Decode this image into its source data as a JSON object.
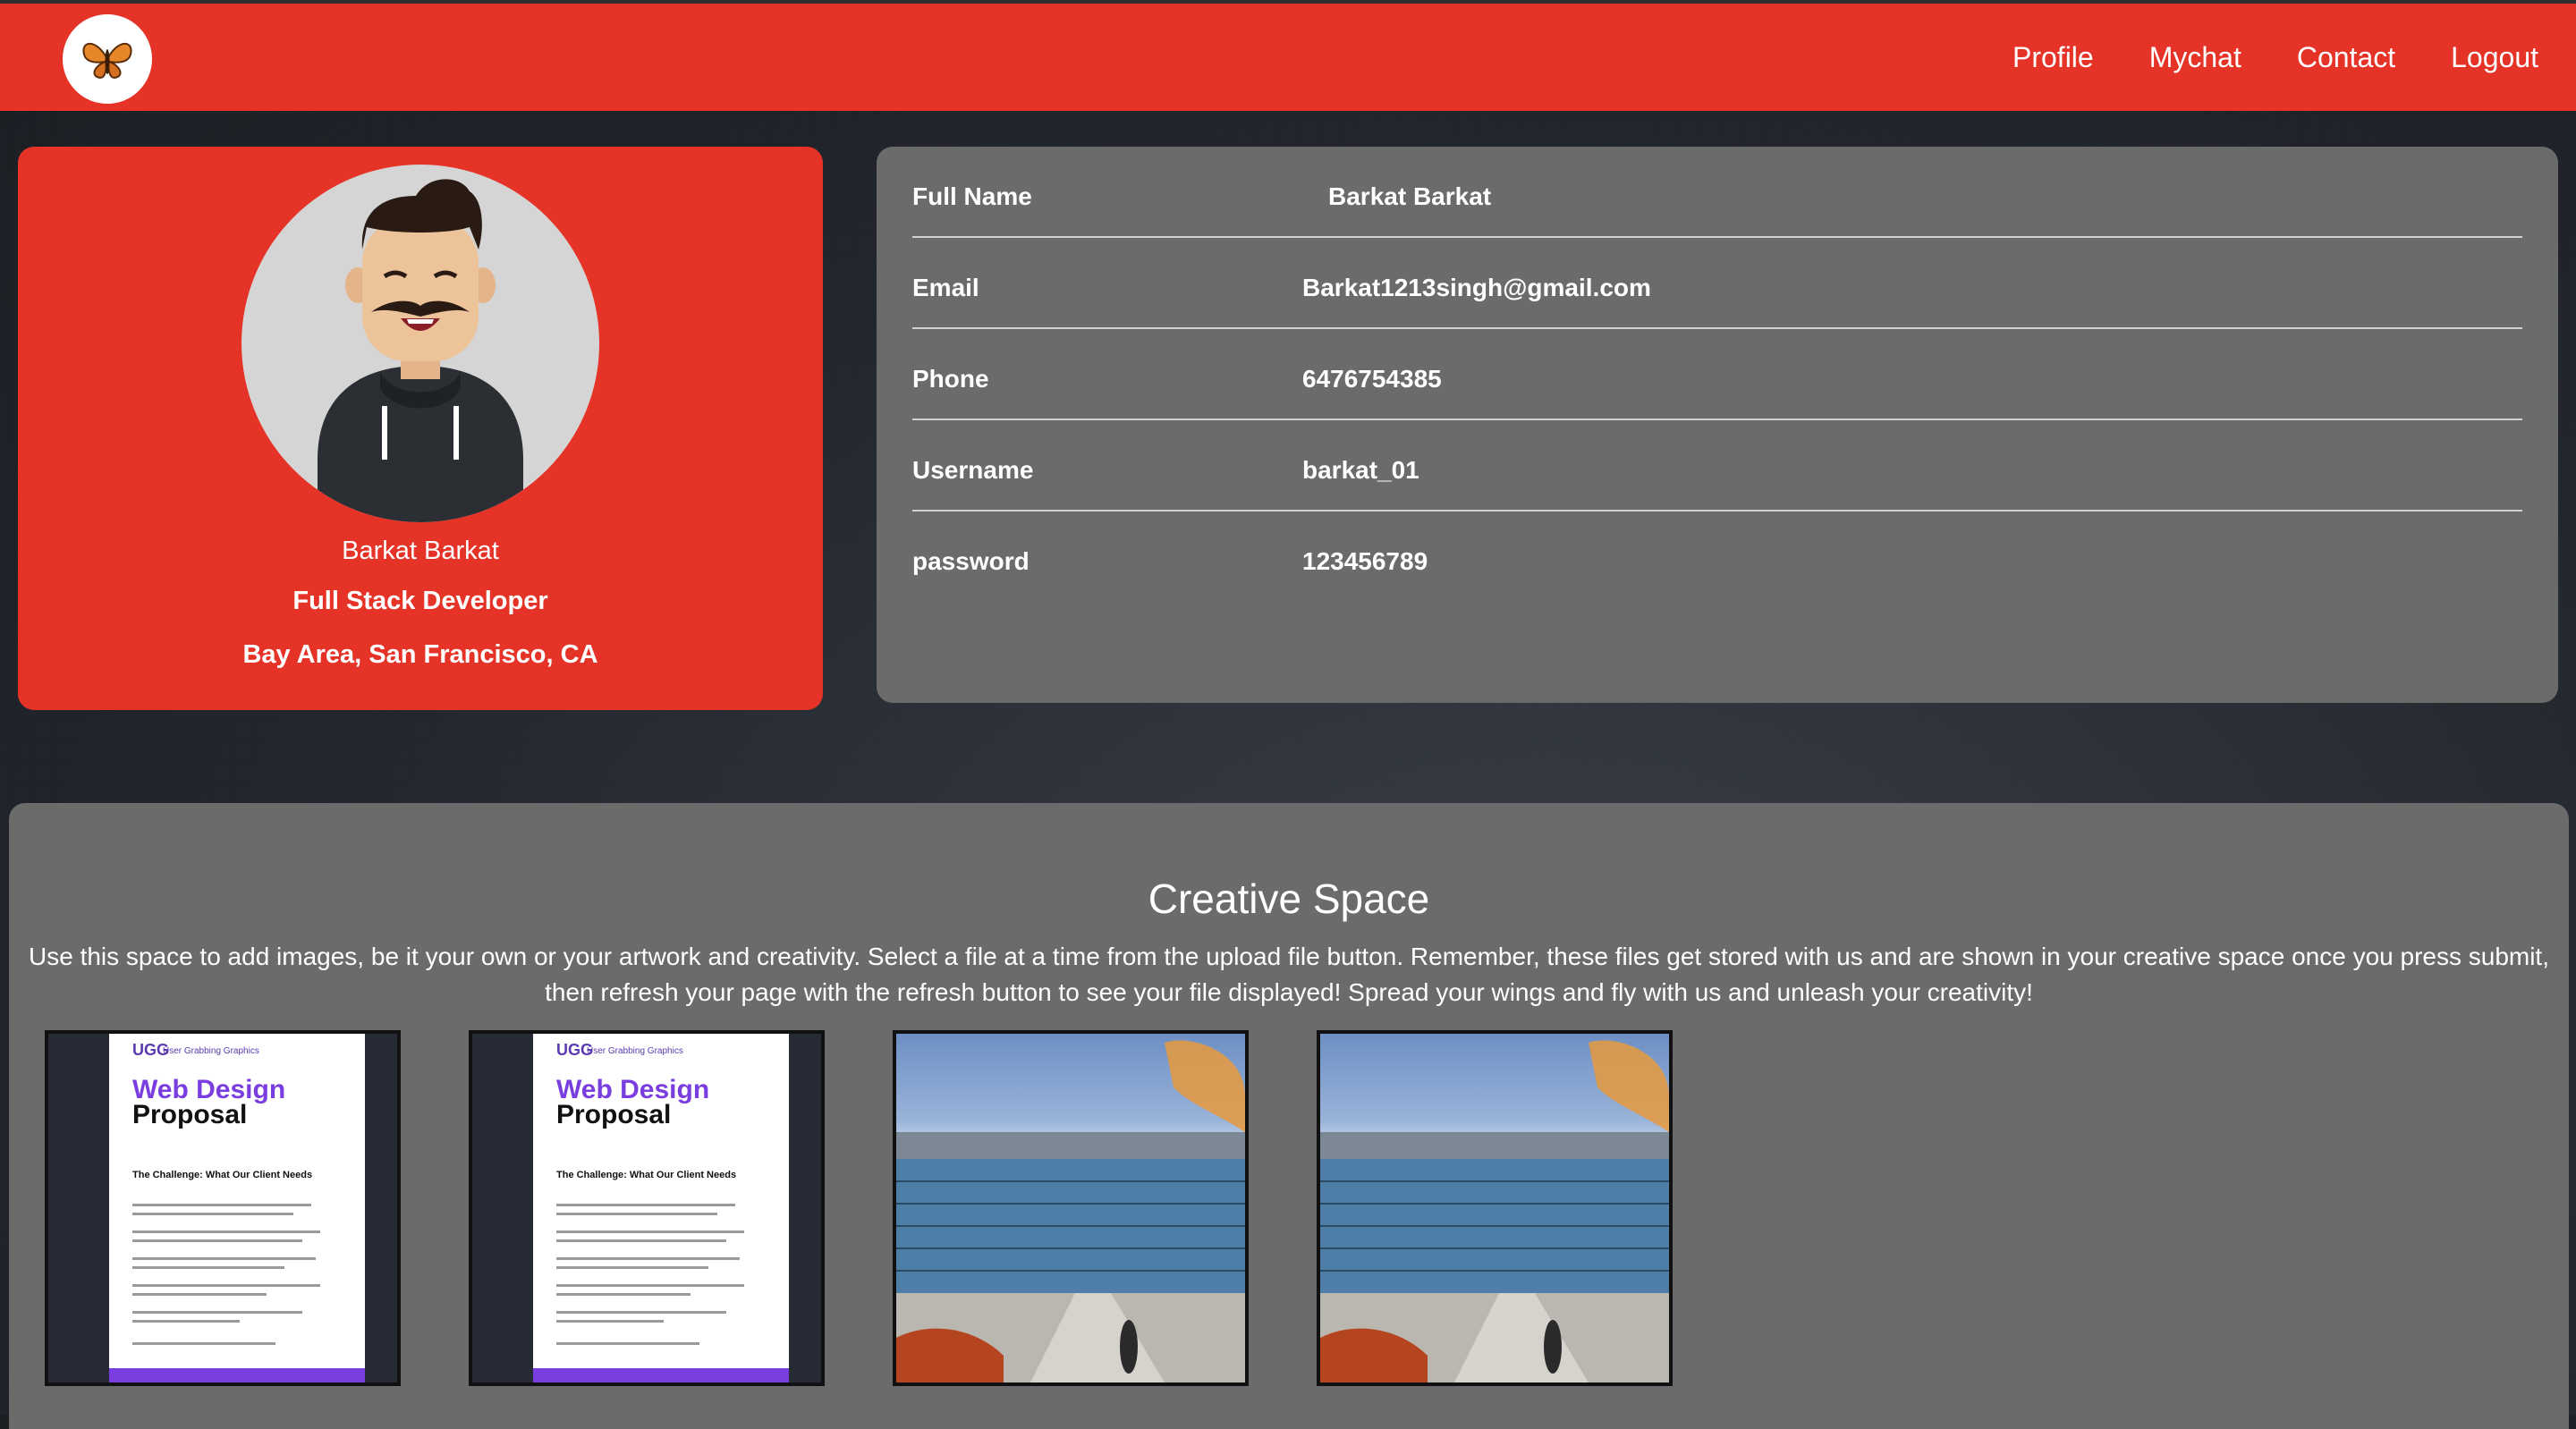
{
  "navbar": {
    "logo_icon": "butterfly-icon",
    "links": [
      "Profile",
      "Mychat",
      "Contact",
      "Logout"
    ]
  },
  "profile_card": {
    "avatar_icon": "man-avatar-icon",
    "name": "Barkat Barkat",
    "title": "Full Stack Developer",
    "location": "Bay Area, San Francisco, CA"
  },
  "details": {
    "rows": [
      {
        "label": "Full Name",
        "value": "Barkat Barkat"
      },
      {
        "label": "Email",
        "value": "Barkat1213singh@gmail.com"
      },
      {
        "label": "Phone",
        "value": "6476754385"
      },
      {
        "label": "Username",
        "value": "barkat_01"
      },
      {
        "label": "password",
        "value": "123456789"
      }
    ]
  },
  "creative_space": {
    "title": "Creative Space",
    "description": "Use this space to add images, be it your own or your artwork and creativity. Select a file at a time from the upload file button. Remember, these files get stored with us and are shown in your creative space once you press submit, then refresh your page with the refresh button to see your file displayed! Spread your wings and fly with us and unleash your creativity!",
    "doc_thumb": {
      "brand": "UGG",
      "brand_sub": "User Grabbing Graphics",
      "heading_1": "Web Design",
      "heading_2": "Proposal",
      "section": "The Challenge: What Our Client Needs"
    },
    "images": [
      {
        "kind": "document",
        "icon": "document-image"
      },
      {
        "kind": "document",
        "icon": "document-image"
      },
      {
        "kind": "photo",
        "icon": "building-photo"
      },
      {
        "kind": "photo",
        "icon": "building-photo"
      }
    ],
    "colors": {
      "accent": "#e63327",
      "panel": "#6b6b6b",
      "doc_purple": "#7a3de0"
    }
  }
}
